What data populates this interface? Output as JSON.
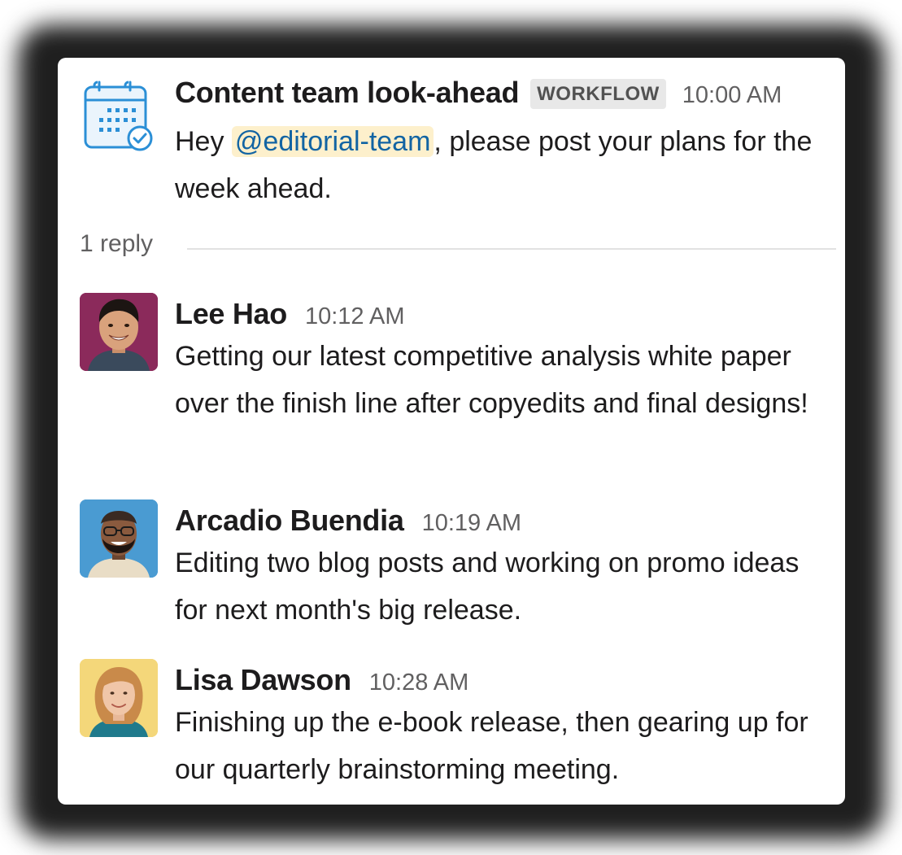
{
  "workflow_message": {
    "title": "Content team look-ahead",
    "badge": "WORKFLOW",
    "time": "10:00 AM",
    "text_before": "Hey ",
    "mention": "@editorial-team",
    "text_after": ", please post your plans for the week ahead.",
    "icon": "calendar-check-icon"
  },
  "thread": {
    "reply_count_label": "1 reply"
  },
  "replies": [
    {
      "name": "Lee Hao",
      "time": "10:12 AM",
      "text": "Getting our latest competitive analysis white paper over the finish line after copyedits and final designs!",
      "avatar_bg": "#8b2a5b"
    },
    {
      "name": "Arcadio Buendia",
      "time": "10:19 AM",
      "text": "Editing two blog posts and working on promo ideas for next month's big release.",
      "avatar_bg": "#4a9bd2"
    },
    {
      "name": "Lisa Dawson",
      "time": "10:28 AM",
      "text": "Finishing up the e-book release, then gearing up for our quarterly brainstorming meeting.",
      "avatar_bg": "#f4d77a"
    }
  ],
  "colors": {
    "mention_text": "#1264a3",
    "mention_bg": "#fdf0cc",
    "icon_blue": "#2b8fd6"
  }
}
